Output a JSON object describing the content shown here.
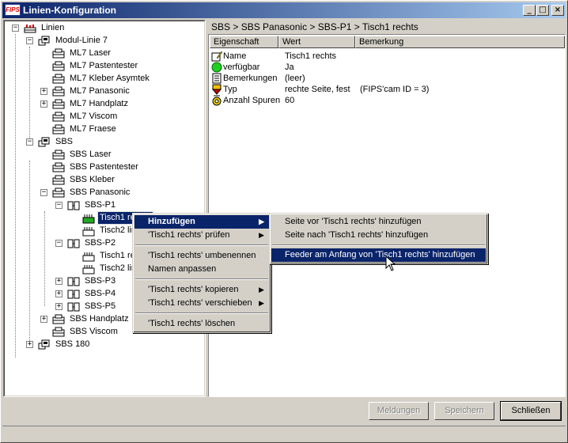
{
  "window": {
    "title": "Linien-Konfiguration",
    "app_icon_text": "FIPS",
    "controls": {
      "minimize": "_",
      "maximize": "□",
      "close": "×"
    }
  },
  "tree": {
    "root": "Linien",
    "modul": "Modul-Linie 7",
    "ml7": [
      "ML7 Laser",
      "ML7 Pastentester",
      "ML7 Kleber Asymtek",
      "ML7 Panasonic",
      "ML7 Handplatz",
      "ML7 Viscom",
      "ML7 Fraese"
    ],
    "sbs": "SBS",
    "sbs_children": [
      "SBS Laser",
      "SBS Pastentester",
      "SBS Kleber",
      "SBS Panasonic"
    ],
    "sbs_p1": "SBS-P1",
    "p1_children": [
      "Tisch1 rechts",
      "Tisch2 links"
    ],
    "sbs_p2": "SBS-P2",
    "p2_children": [
      "Tisch1 rechts",
      "Tisch2 links"
    ],
    "sbs_p345": [
      "SBS-P3",
      "SBS-P4",
      "SBS-P5"
    ],
    "sbs_rest": [
      "SBS Handplatz",
      "SBS Viscom"
    ],
    "sbs180": "SBS 180"
  },
  "breadcrumb": "SBS > SBS Panasonic > SBS-P1 > Tisch1 rechts",
  "properties": {
    "columns": [
      "Eigenschaft",
      "Wert",
      "Bemerkung"
    ],
    "rows": [
      {
        "icon": "name-icon",
        "name": "Name",
        "value": "Tisch1 rechts",
        "note": ""
      },
      {
        "icon": "available-icon",
        "name": "verfügbar",
        "value": "Ja",
        "note": ""
      },
      {
        "icon": "notes-icon",
        "name": "Bemerkungen",
        "value": "(leer)",
        "note": ""
      },
      {
        "icon": "type-icon",
        "name": "Typ",
        "value": "rechte Seite, fest",
        "note": "(FIPS'cam ID = 3)"
      },
      {
        "icon": "tracks-icon",
        "name": "Anzahl Spuren",
        "value": "60",
        "note": ""
      }
    ]
  },
  "context_menu": {
    "items": [
      "Hinzufügen",
      "'Tisch1 rechts' prüfen",
      "'Tisch1 rechts' umbenennen",
      "Namen anpassen",
      "'Tisch1 rechts' kopieren",
      "'Tisch1 rechts' verschieben",
      "'Tisch1 rechts' löschen"
    ]
  },
  "submenu": {
    "items": [
      "Seite vor 'Tisch1 rechts' hinzufügen",
      "Seite nach 'Tisch1 rechts' hinzufügen",
      "Feeder am Anfang von 'Tisch1 rechts' hinzufügen"
    ]
  },
  "buttons": {
    "messages": "Meldungen",
    "save": "Speichern",
    "close": "Schließen"
  },
  "colors": {
    "selection": "#0a246a",
    "face": "#d4d0c8",
    "green": "#22aa22"
  }
}
